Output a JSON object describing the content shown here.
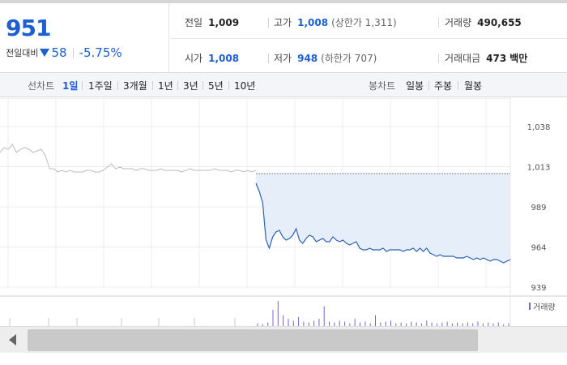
{
  "quote": {
    "price": "951",
    "change_label": "전일대비",
    "change_amount": "58",
    "change_pct": "-5.75%",
    "direction": "down",
    "accent_color": "#1d5fd0",
    "prev_close_label": "전일",
    "prev_close": "1,009",
    "high_label": "고가",
    "high": "1,008",
    "upper_limit": "(상한가 1,311)",
    "volume_label": "거래량",
    "volume": "490,655",
    "open_label": "시가",
    "open": "1,008",
    "low_label": "저가",
    "low": "948",
    "lower_limit": "(하한가 707)",
    "amount_label": "거래대금",
    "amount": "473",
    "amount_unit": "백만"
  },
  "toolbar": {
    "line_label": "선차트",
    "periods": [
      "1일",
      "1주일",
      "3개월",
      "1년",
      "3년",
      "5년",
      "10년"
    ],
    "active_period": "1일",
    "candle_label": "봉차트",
    "candle_periods": [
      "일봉",
      "주봉",
      "월봉"
    ]
  },
  "chart_data": {
    "type": "line",
    "y_ticks": [
      "1,038",
      "1,013",
      "989",
      "964",
      "939"
    ],
    "ylim": [
      939,
      1038
    ],
    "reference_line": 1009,
    "previous_series": {
      "name": "",
      "color": "#bdbdbd",
      "values": [
        1022,
        1025,
        1024,
        1027,
        1022,
        1024,
        1025,
        1024,
        1022,
        1023,
        1024,
        1020,
        1012,
        1012,
        1010,
        1011,
        1010,
        1011,
        1010,
        1010,
        1010,
        1011,
        1011,
        1010,
        1010,
        1011,
        1013,
        1015,
        1012,
        1013,
        1012,
        1012,
        1012,
        1011,
        1012,
        1012,
        1011,
        1011,
        1011,
        1012,
        1011,
        1011,
        1011,
        1011,
        1010,
        1011,
        1012,
        1011,
        1011,
        1011,
        1011,
        1011,
        1012,
        1011,
        1011,
        1011,
        1010,
        1011,
        1011,
        1010,
        1011,
        1010,
        1011
      ]
    },
    "today_series": {
      "name": "",
      "color": "#2b5fb8",
      "fill_color": "#e6eef9",
      "values": [
        1003,
        998,
        991,
        968,
        963,
        970,
        973,
        974,
        970,
        968,
        969,
        971,
        975,
        968,
        966,
        969,
        971,
        970,
        967,
        968,
        969,
        967,
        967,
        970,
        968,
        967,
        968,
        966,
        965,
        966,
        967,
        963,
        962,
        962,
        963,
        962,
        962,
        962,
        963,
        961,
        962,
        962,
        962,
        962,
        961,
        962,
        962,
        963,
        961,
        963,
        961,
        963,
        960,
        959,
        958,
        959,
        958,
        958,
        958,
        958,
        957,
        957,
        957,
        958,
        957,
        956,
        957,
        956,
        957,
        956,
        955,
        956,
        956,
        955,
        954,
        955,
        956
      ]
    },
    "volume": {
      "legend": "거래량",
      "color": "#7a63c8",
      "values": [
        3,
        2,
        4,
        18,
        28,
        12,
        8,
        6,
        10,
        5,
        4,
        6,
        8,
        22,
        5,
        4,
        6,
        5,
        3,
        8,
        4,
        5,
        3,
        12,
        4,
        5,
        6,
        3,
        4,
        3,
        5,
        4,
        3,
        6,
        4,
        3,
        4,
        5,
        3,
        4,
        3,
        4,
        3,
        5,
        3,
        4,
        3,
        4,
        2,
        3
      ]
    }
  },
  "scrollbar": {
    "left_arrow": "left-arrow-icon"
  }
}
